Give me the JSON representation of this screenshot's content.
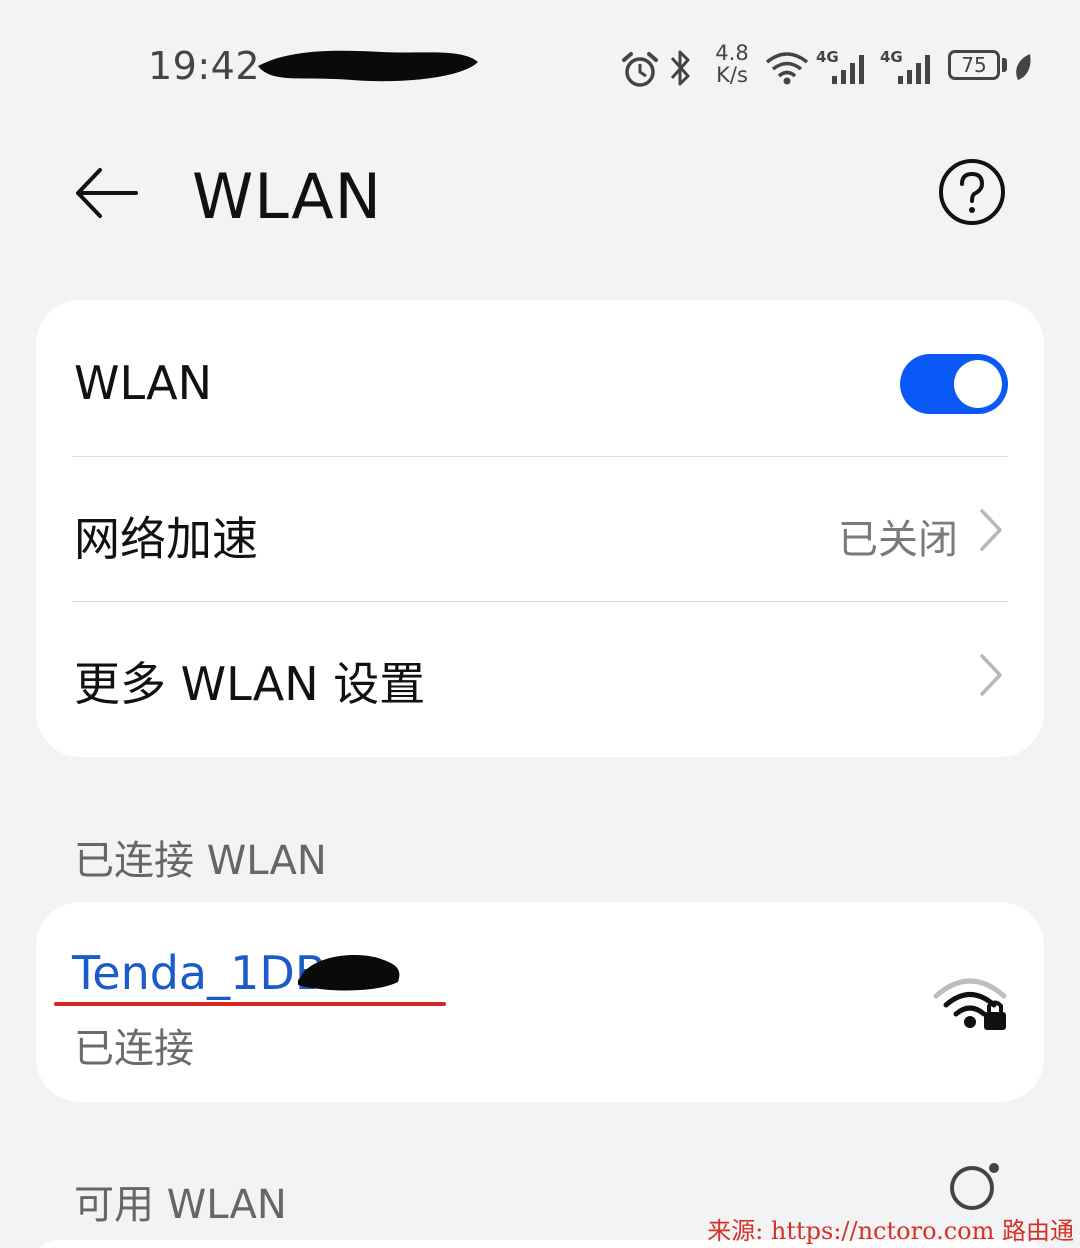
{
  "status_bar": {
    "time": "19:42",
    "net_speed_value": "4.8",
    "net_speed_unit": "K/s",
    "network_type_1": "4G",
    "network_type_2": "4G",
    "battery_level": "75",
    "icons": [
      "alarm-icon",
      "bluetooth-icon",
      "wifi-status-icon",
      "cellular-signal-icon",
      "cellular-signal-icon",
      "battery-icon",
      "eco-leaf-icon"
    ]
  },
  "header": {
    "title": "WLAN"
  },
  "settings": {
    "wlan_label": "WLAN",
    "wlan_enabled": true,
    "accel_label": "网络加速",
    "accel_value": "已关闭",
    "more_label": "更多 WLAN 设置"
  },
  "connected": {
    "section_title": "已连接 WLAN",
    "network_name": "Tenda_1DB",
    "status": "已连接"
  },
  "available": {
    "section_title": "可用 WLAN"
  },
  "watermark": "来源: https://nctoro.com 路由通",
  "colors": {
    "accent": "#0a59f7",
    "network_name": "#1a5bc9",
    "underline": "#d62323",
    "background": "#f1f3f5",
    "card": "#ffffff"
  }
}
